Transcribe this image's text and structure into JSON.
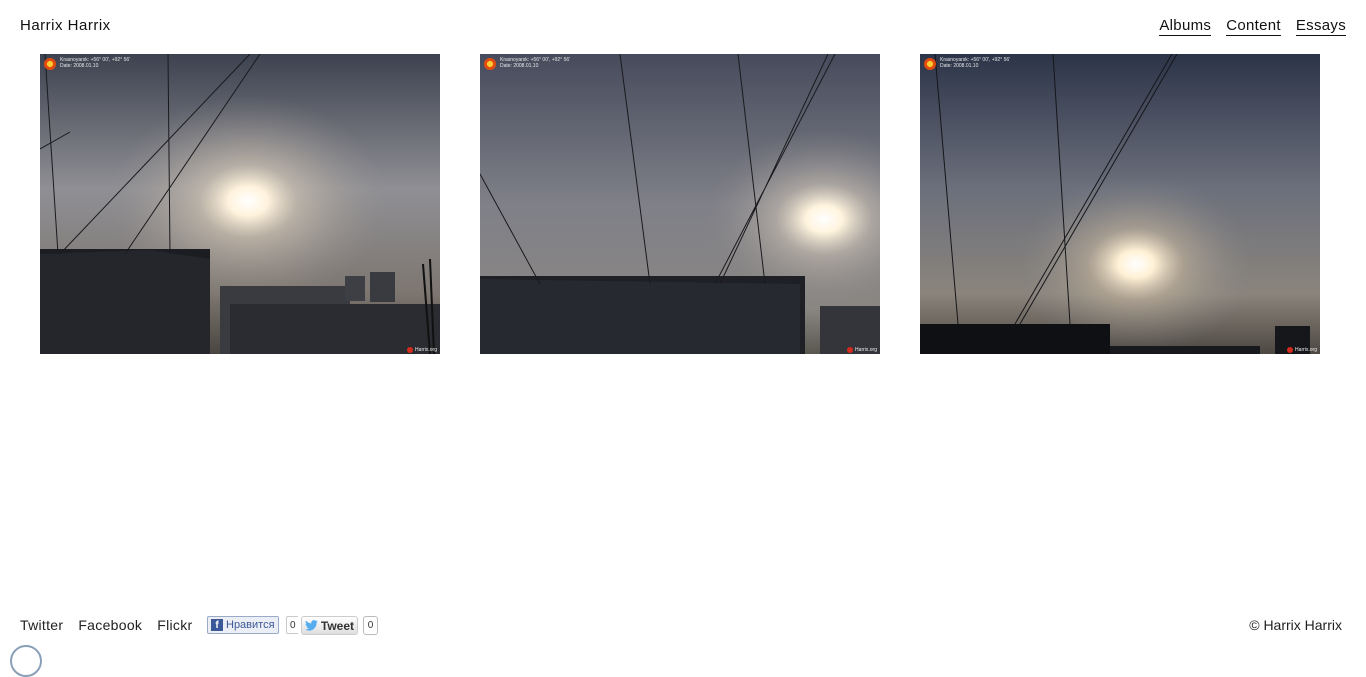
{
  "site": {
    "title": "Harrix Harrix"
  },
  "nav": [
    {
      "label": "Albums"
    },
    {
      "label": "Content"
    },
    {
      "label": "Essays"
    }
  ],
  "photos": [
    {
      "caption_line1": "Krasnoyarsk: +56° 00', +92° 56'",
      "caption_line2": "Date: 2008.01.10",
      "watermark": "Harrix.org"
    },
    {
      "caption_line1": "Krasnoyarsk: +56° 00', +92° 56'",
      "caption_line2": "Date: 2008.01.10",
      "watermark": "Harrix.org"
    },
    {
      "caption_line1": "Krasnoyarsk: +56° 00', +92° 56'",
      "caption_line2": "Date: 2008.01.10",
      "watermark": "Harrix.org"
    }
  ],
  "footer": {
    "links": [
      {
        "label": "Twitter"
      },
      {
        "label": "Facebook"
      },
      {
        "label": "Flickr"
      }
    ],
    "facebook_like": {
      "label": "Нравится",
      "count": "0",
      "icon": "facebook-icon"
    },
    "tweet": {
      "label": "Tweet",
      "count": "0",
      "icon": "twitter-bird-icon"
    },
    "copyright": "© Harrix Harrix"
  },
  "colors": {
    "facebook": "#3b5998",
    "twitter": "#55acee",
    "text": "#222222"
  }
}
